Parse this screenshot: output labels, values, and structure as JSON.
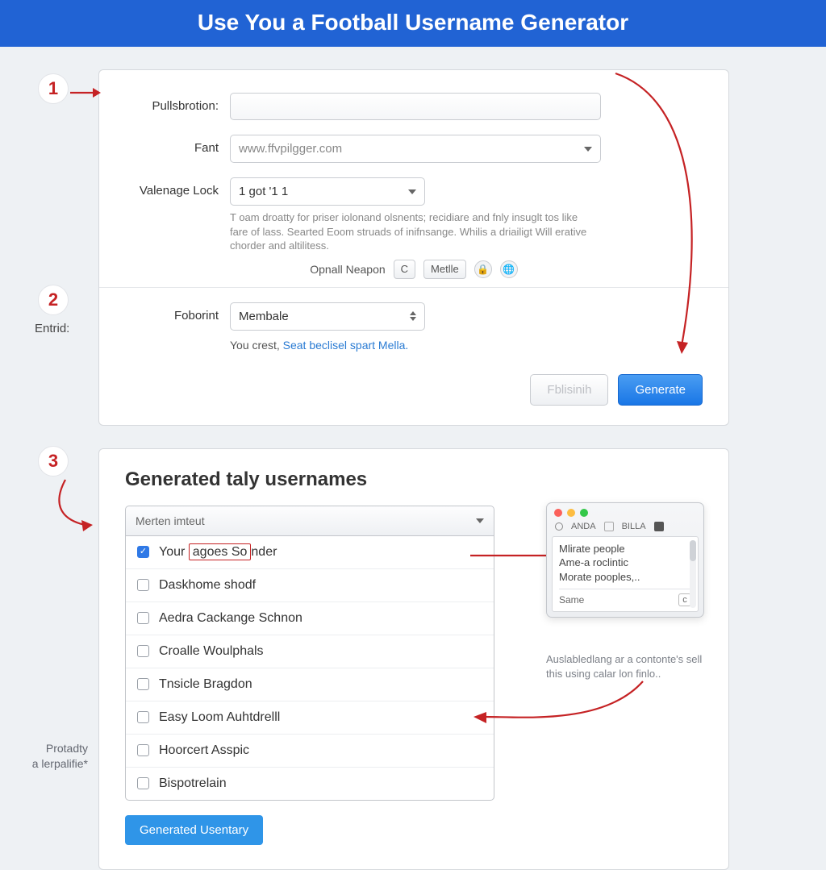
{
  "header": {
    "title": "Use You a Football Username Generator"
  },
  "step_labels": {
    "one": "1",
    "two": "2",
    "two_caption": "Entrid:",
    "three": "3"
  },
  "form": {
    "pullsbrotion_label": "Pullsbrotion:",
    "fant_label": "Fant",
    "fant_placeholder": "www.ffvpilgger.com",
    "valenage_label": "Valenage Lock",
    "valenage_value": "1 got '1  1",
    "help_text": "T oam droatty for priser iolonand olsnents; recidiare and fnly insuglt tos like fare of lass. Searted Eoom struads of inifnsange. Whilis a driailigt Will erative chorder and altilitess.",
    "opnail_label": "Opnall Neapon",
    "opnail_c": "C",
    "opnail_mettle": "Metlle",
    "foborint_label": "Foborint",
    "foborint_value": "Membale",
    "subtext_prefix": "You crest, ",
    "subtext_link": "Seat beclisel spart Mella.",
    "btn_secondary": "Fblisinih",
    "btn_primary": "Generate"
  },
  "results": {
    "title": "Generated taly usernames",
    "filter_value": "Merten imteut",
    "items": [
      {
        "checked": true,
        "text_pre": "Your",
        "text_hi": "agoes So",
        "text_post": "nder"
      },
      {
        "checked": false,
        "text": "Daskhome shodf"
      },
      {
        "checked": false,
        "text": "Aedra Cackange Schnon"
      },
      {
        "checked": false,
        "text": "Croalle Woulphals"
      },
      {
        "checked": false,
        "text": "Tnsicle Bragdon"
      },
      {
        "checked": false,
        "text": "Easy Loom Auhtdrelll"
      },
      {
        "checked": false,
        "text": "Hoorcert Asspic"
      },
      {
        "checked": false,
        "text": "Bispotrelain"
      }
    ],
    "action_button": "Generated Usentary",
    "preview": {
      "tab1": "ANDA",
      "tab2": "BILLA",
      "line1": "Mlirate people",
      "line2": "Ame-a roclintic",
      "line3": "Morate pooples,..",
      "footer": "Same",
      "footer_c": "c"
    },
    "preview_caption": "Auslabledlang ar a contonte's sell this using calar lon finlo..",
    "left_caption_l1": "Protadty",
    "left_caption_l2": "a lerpalifie*"
  },
  "colors": {
    "accent_red": "#c52224",
    "brand_blue": "#2163d4"
  }
}
